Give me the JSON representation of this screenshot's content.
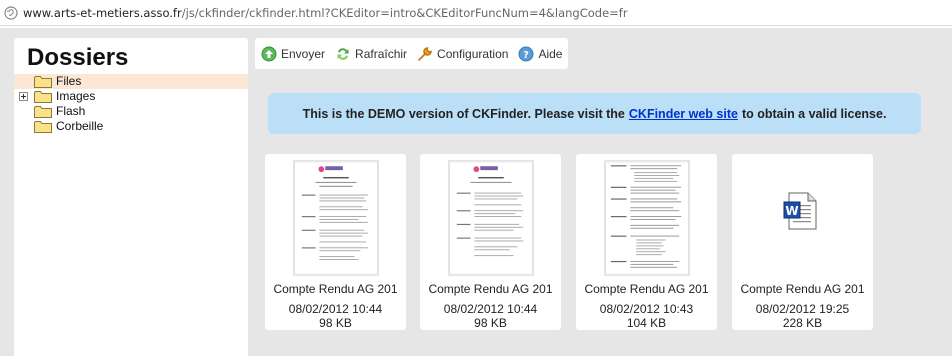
{
  "url": {
    "domain": "www.arts-et-metiers.asso.fr",
    "path": "/js/ckfinder/ckfinder.html?CKEditor=intro&CKEditorFuncNum=4&langCode=fr"
  },
  "sidebar": {
    "title": "Dossiers",
    "folders": [
      {
        "label": "Files",
        "selected": true,
        "expandable": false
      },
      {
        "label": "Images",
        "selected": false,
        "expandable": true
      },
      {
        "label": "Flash",
        "selected": false,
        "expandable": false
      },
      {
        "label": "Corbeille",
        "selected": false,
        "expandable": false
      }
    ]
  },
  "toolbar": {
    "upload_label": "Envoyer",
    "refresh_label": "Rafraîchir",
    "settings_label": "Configuration",
    "help_label": "Aide"
  },
  "banner": {
    "text_before": "This is the DEMO version of CKFinder. Please visit the",
    "link_text": "CKFinder web site",
    "text_after": "to obtain a valid license."
  },
  "files": [
    {
      "name": "Compte Rendu AG 201",
      "date": "08/02/2012 10:44",
      "size": "98 KB",
      "type": "pdf-thumb"
    },
    {
      "name": "Compte Rendu AG 201",
      "date": "08/02/2012 10:44",
      "size": "98 KB",
      "type": "pdf-thumb"
    },
    {
      "name": "Compte Rendu AG 201",
      "date": "08/02/2012 10:43",
      "size": "104 KB",
      "type": "text-thumb"
    },
    {
      "name": "Compte Rendu AG 201",
      "date": "08/02/2012 19:25",
      "size": "228 KB",
      "type": "word-icon"
    }
  ],
  "colors": {
    "frame_bg": "#e6e6e6",
    "selected_folder_bg": "#fbe7d3",
    "banner_bg": "#bcdff8",
    "link": "#0033cc"
  }
}
